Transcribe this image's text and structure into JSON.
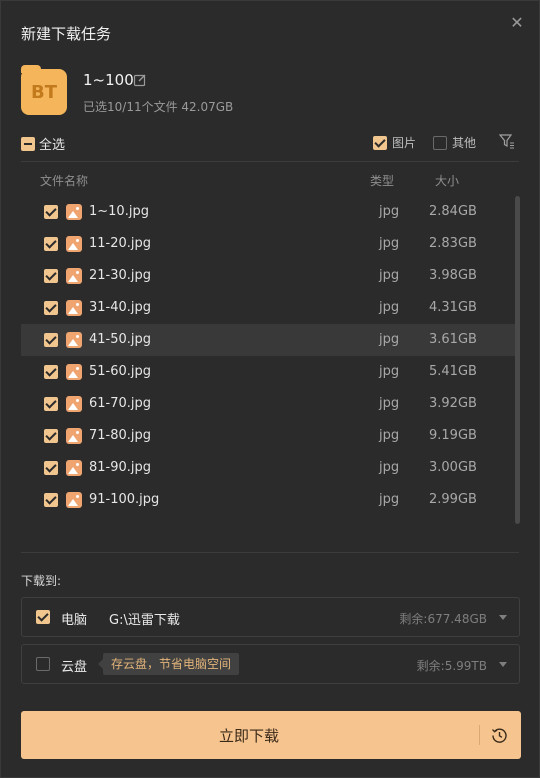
{
  "dialog": {
    "title": "新建下载任务",
    "close_glyph": "✕"
  },
  "task": {
    "icon_text": "BT",
    "name": "1~100",
    "summary": "已选10/11个文件 42.07GB"
  },
  "toolbar": {
    "select_all": "全选",
    "filter_image": "图片",
    "filter_other": "其他"
  },
  "columns": {
    "name": "文件名称",
    "type": "类型",
    "size": "大小"
  },
  "files": [
    {
      "name": "1~10.jpg",
      "type": "jpg",
      "size": "2.84GB"
    },
    {
      "name": "11-20.jpg",
      "type": "jpg",
      "size": "2.83GB"
    },
    {
      "name": "21-30.jpg",
      "type": "jpg",
      "size": "3.98GB"
    },
    {
      "name": "31-40.jpg",
      "type": "jpg",
      "size": "4.31GB"
    },
    {
      "name": "41-50.jpg",
      "type": "jpg",
      "size": "3.61GB"
    },
    {
      "name": "51-60.jpg",
      "type": "jpg",
      "size": "5.41GB"
    },
    {
      "name": "61-70.jpg",
      "type": "jpg",
      "size": "3.92GB"
    },
    {
      "name": "71-80.jpg",
      "type": "jpg",
      "size": "9.19GB"
    },
    {
      "name": "81-90.jpg",
      "type": "jpg",
      "size": "3.00GB"
    },
    {
      "name": "91-100.jpg",
      "type": "jpg",
      "size": "2.99GB"
    }
  ],
  "download_to": {
    "label": "下载到:",
    "local": {
      "name": "电脑",
      "path": "G:\\迅雷下载",
      "free": "剩余:677.48GB"
    },
    "cloud": {
      "name": "云盘",
      "tip": "存云盘，节省电脑空间",
      "free": "剩余:5.99TB"
    }
  },
  "actions": {
    "download_now": "立即下载"
  },
  "colors": {
    "accent": "#f6c48e",
    "checkbox": "#f0c58e",
    "bt_icon": "#f5b55a",
    "image_icon": "#f0a571"
  }
}
